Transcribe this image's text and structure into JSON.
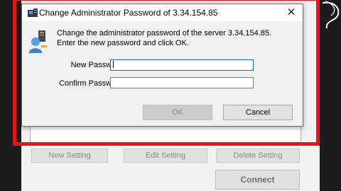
{
  "dialog": {
    "title": "Change Administrator Password of 3.34.154.85",
    "close_glyph": "✕",
    "message": "Change the administrator password of the server 3.34.154.85. Enter the new password and click OK.",
    "new_password_label": "New Password:",
    "new_password_value": "",
    "confirm_password_label": "Confirm Password:",
    "confirm_password_value": "",
    "ok_label": "OK",
    "cancel_label": "Cancel",
    "title_icon": "server-icon",
    "message_icon": "user-key-icon"
  },
  "background": {
    "new_setting_label": "New Setting",
    "edit_setting_label": "Edit Setting",
    "delete_setting_label": "Delete Setting",
    "connect_label": "Connect"
  },
  "colors": {
    "highlight": "#e8141c",
    "dialog_bg": "#f0f0f0",
    "focus": "#1a64b6"
  }
}
